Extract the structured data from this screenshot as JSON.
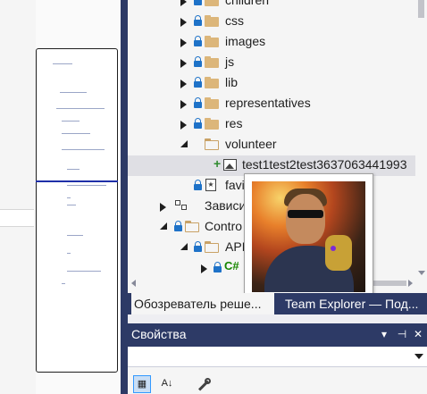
{
  "explorer": {
    "items": [
      {
        "label": "children"
      },
      {
        "label": "css"
      },
      {
        "label": "images"
      },
      {
        "label": "js"
      },
      {
        "label": "lib"
      },
      {
        "label": "representatives"
      },
      {
        "label": "res"
      },
      {
        "label": "volunteer"
      },
      {
        "label": "test1test2test3637063441993"
      },
      {
        "label": "favi"
      },
      {
        "label": "Зависи"
      },
      {
        "label": "Contro"
      },
      {
        "label": "API"
      },
      {
        "label": "C#"
      }
    ]
  },
  "tabs": [
    {
      "label": "Обозреватель реше..."
    },
    {
      "label": "Team Explorer — Под..."
    }
  ],
  "properties": {
    "title": "Свойства",
    "dropdown_glyph": "▾",
    "pin_glyph": "⊣",
    "close_glyph": "✕"
  },
  "toolbar": {
    "categorized_glyph": "▦",
    "alphabetical_glyph": "A↓"
  },
  "colors": {
    "accent_dark": "#2D3A66",
    "lock_blue": "#1E72C8",
    "folder": "#DCB67A",
    "added_green": "#2E8B2E"
  },
  "preview": {
    "description_icon": "image-preview"
  }
}
